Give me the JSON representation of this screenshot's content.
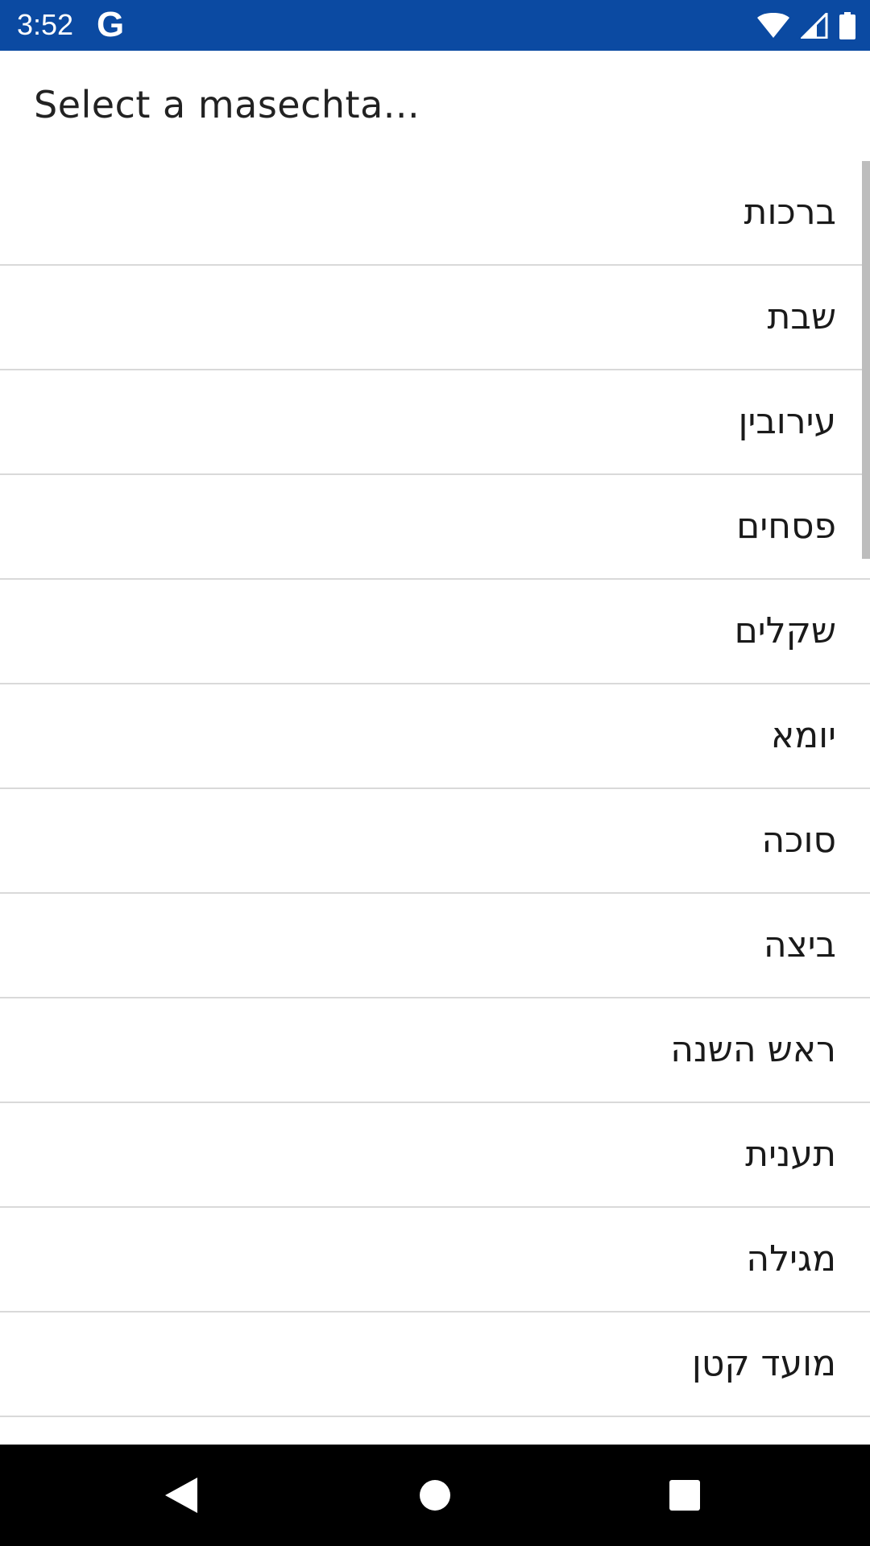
{
  "status_bar": {
    "time": "3:52",
    "google_letter": "G",
    "icons": [
      "wifi-icon",
      "cell-signal-icon",
      "battery-icon"
    ],
    "background_color": "#0b4aa2"
  },
  "dialog": {
    "title": "Select a masechta..."
  },
  "list": {
    "items": [
      {
        "label": "ברכות"
      },
      {
        "label": "שבת"
      },
      {
        "label": "עירובין"
      },
      {
        "label": "פסחים"
      },
      {
        "label": "שקלים"
      },
      {
        "label": "יומא"
      },
      {
        "label": "סוכה"
      },
      {
        "label": "ביצה"
      },
      {
        "label": "ראש השנה"
      },
      {
        "label": "תענית"
      },
      {
        "label": "מגילה"
      },
      {
        "label": "מועד קטן"
      },
      {
        "label": ""
      }
    ]
  },
  "nav_bar": {
    "buttons": [
      "back-icon",
      "home-icon",
      "recents-icon"
    ]
  }
}
